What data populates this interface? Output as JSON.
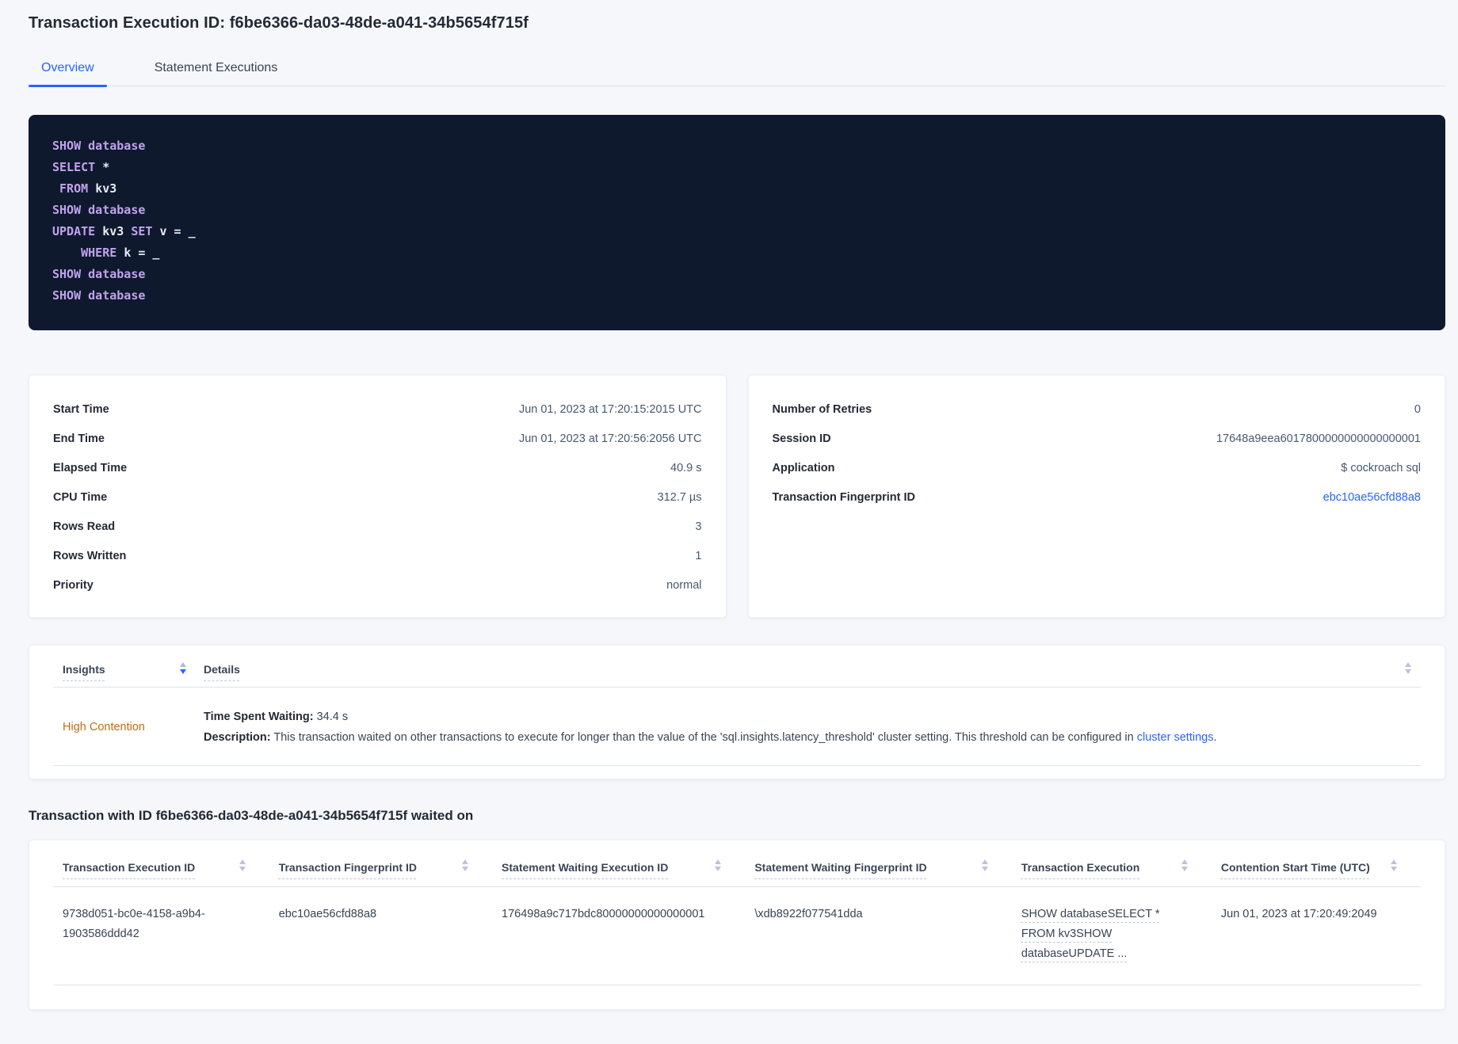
{
  "page_title": "Transaction Execution ID: f6be6366-da03-48de-a041-34b5654f715f",
  "tabs": {
    "overview": "Overview",
    "statement_executions": "Statement Executions"
  },
  "colors": {
    "accent_blue": "#2962ff",
    "insight_orange": "#bf6c1b",
    "sql_keyword": "#c2a2ec",
    "sql_box_bg": "#0f192e"
  },
  "sql": {
    "l1": {
      "a": "SHOW database"
    },
    "l2": {
      "a": "SELECT ",
      "b": "*"
    },
    "l3": {
      "a": " ",
      "b": "FROM ",
      "c": "kv3"
    },
    "l4": {
      "a": "SHOW database"
    },
    "l5": {
      "a": "UPDATE ",
      "b": "kv3 ",
      "c": "SET ",
      "d": "v = _"
    },
    "l6": {
      "a": "    ",
      "b": "WHERE ",
      "c": "k = _"
    },
    "l7": {
      "a": "SHOW database"
    },
    "l8": {
      "a": "SHOW database"
    }
  },
  "summary_left": {
    "rows": [
      {
        "label": "Start Time",
        "value": "Jun 01, 2023 at 17:20:15:2015 UTC"
      },
      {
        "label": "End Time",
        "value": "Jun 01, 2023 at 17:20:56:2056 UTC"
      },
      {
        "label": "Elapsed Time",
        "value": "40.9 s"
      },
      {
        "label": "CPU Time",
        "value": "312.7 µs"
      },
      {
        "label": "Rows Read",
        "value": "3"
      },
      {
        "label": "Rows Written",
        "value": "1"
      },
      {
        "label": "Priority",
        "value": "normal"
      }
    ]
  },
  "summary_right": {
    "rows": [
      {
        "label": "Number of Retries",
        "value": "0"
      },
      {
        "label": "Session ID",
        "value": "17648a9eea6017800000000000000001"
      },
      {
        "label": "Application",
        "value": "$ cockroach sql"
      },
      {
        "label": "Transaction Fingerprint ID",
        "value": "ebc10ae56cfd88a8"
      }
    ]
  },
  "insights": {
    "headers": {
      "insights": "Insights",
      "details": "Details"
    },
    "row": {
      "insight": "High Contention",
      "waiting_label": "Time Spent Waiting:",
      "waiting_value": " 34.4 s",
      "description_label": "Description:",
      "description_text": " This transaction waited on other transactions to execute for longer than the value of the 'sql.insights.latency_threshold' cluster setting. This threshold can be configured in ",
      "description_link": "cluster settings",
      "description_suffix": "."
    }
  },
  "waited_on": {
    "heading": "Transaction with ID f6be6366-da03-48de-a041-34b5654f715f waited on",
    "headers": [
      "Transaction Execution ID",
      "Transaction Fingerprint ID",
      "Statement Waiting Execution ID",
      "Statement Waiting Fingerprint ID",
      "Transaction Execution",
      "Contention Start Time (UTC)"
    ],
    "row": {
      "transaction_execution_id": "9738d051-bc0e-4158-a9b4-1903586ddd42",
      "transaction_fingerprint_id": "ebc10ae56cfd88a8",
      "statement_waiting_execution_id": "176498a9c717bdc80000000000000001",
      "statement_waiting_fingerprint_id": "\\xdb8922f077541dda",
      "transaction_execution": "SHOW databaseSELECT * FROM kv3SHOW databaseUPDATE ...",
      "contention_start_time": "Jun 01, 2023 at 17:20:49:2049"
    }
  }
}
